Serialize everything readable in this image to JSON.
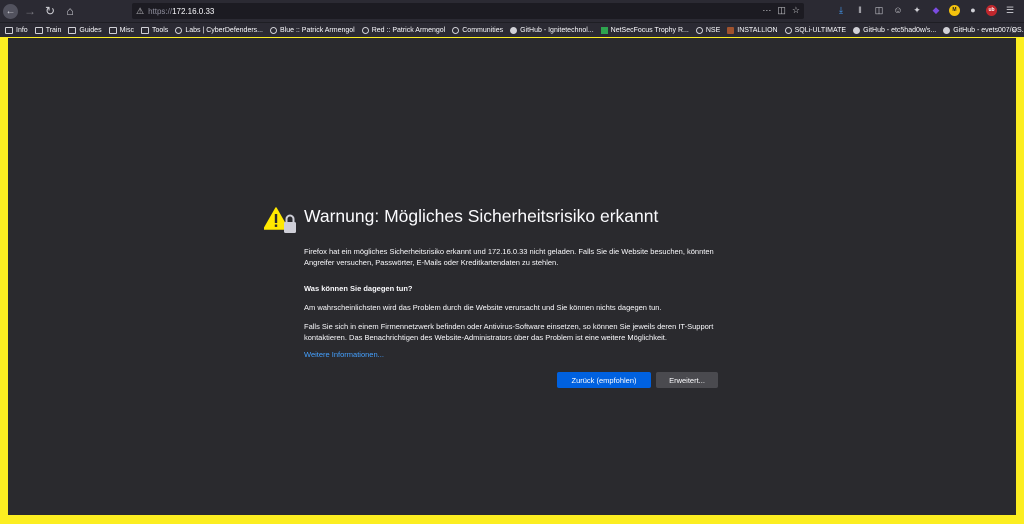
{
  "browser": {
    "url_protocol": "https://",
    "url_host": "172.16.0.33"
  },
  "bookmarks": [
    {
      "label": "Info",
      "icon": "folder"
    },
    {
      "label": "Train",
      "icon": "folder"
    },
    {
      "label": "Guides",
      "icon": "folder"
    },
    {
      "label": "Misc",
      "icon": "folder"
    },
    {
      "label": "Tools",
      "icon": "folder"
    },
    {
      "label": "Labs | CyberDefenders...",
      "icon": "globe"
    },
    {
      "label": "Blue :: Patrick Armengol",
      "icon": "globe"
    },
    {
      "label": "Red :: Patrick Armengol",
      "icon": "globe"
    },
    {
      "label": "Communities",
      "icon": "globe"
    },
    {
      "label": "GitHub - Ignitetechnol...",
      "icon": "github"
    },
    {
      "label": "NetSecFocus Trophy R...",
      "icon": "netsecfocus"
    },
    {
      "label": "NSE",
      "icon": "globe"
    },
    {
      "label": "INSTALLION",
      "icon": "installion"
    },
    {
      "label": "SQLi-ULTIMATE",
      "icon": "globe"
    },
    {
      "label": "GitHub - etc5had0w/s...",
      "icon": "github"
    },
    {
      "label": "GitHub - evets007/OS...",
      "icon": "github"
    }
  ],
  "extension_badges": {
    "yellow": "M",
    "red": "ub"
  },
  "error_page": {
    "title": "Warnung: Mögliches Sicherheitsrisiko erkannt",
    "intro": "Firefox hat ein mögliches Sicherheitsrisiko erkannt und 172.16.0.33 nicht geladen. Falls Sie die Website besuchen, könnten Angreifer versuchen, Passwörter, E-Mails oder Kreditkartendaten zu stehlen.",
    "heading": "Was können Sie dagegen tun?",
    "para1": "Am wahrscheinlichsten wird das Problem durch die Website verursacht und Sie können nichts dagegen tun.",
    "para2": "Falls Sie sich in einem Firmennetzwerk befinden oder Antivirus-Software einsetzen, so können Sie jeweils deren IT-Support kontaktieren. Das Benachrichtigen des Website-Administrators über das Problem ist eine weitere Möglichkeit.",
    "more_info_link": "Weitere Informationen...",
    "primary_button": "Zurück (empfohlen)",
    "secondary_button": "Erweitert..."
  },
  "colors": {
    "frame": "#fcee21",
    "page_bg": "#2a2a2e",
    "primary_button": "#0061e0",
    "link": "#45a1ff",
    "warning": "#ffe900"
  }
}
